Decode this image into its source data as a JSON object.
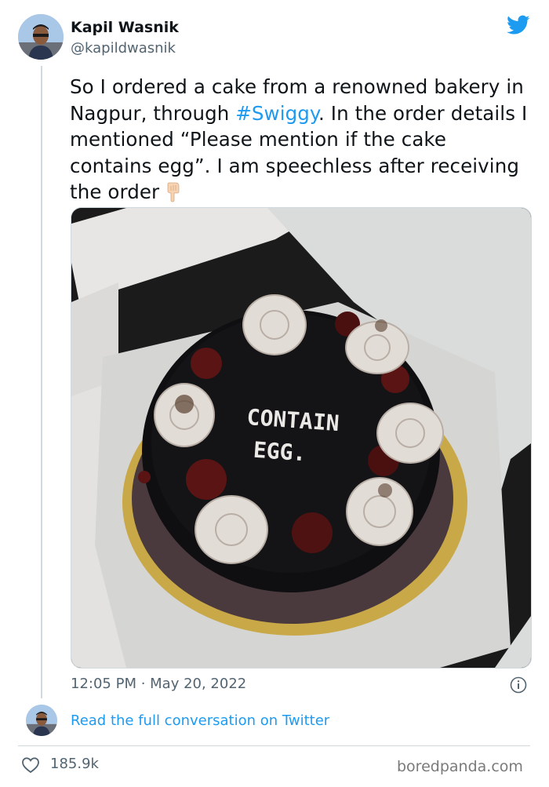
{
  "author": {
    "display_name": "Kapil Wasnik",
    "handle": "@kapildwasnik"
  },
  "tweet": {
    "text_before": "So I ordered a cake from a renowned bakery in Nagpur, through ",
    "hashtag": "#Swiggy",
    "text_after": ". In the order details I mentioned “Please mention if the cake contains egg”. I am speechless after receiving the order",
    "emoji": "pointing-down-hand-emoji",
    "photo_icing_text_line1": "CONTAIN",
    "photo_icing_text_line2": "EGG.",
    "timestamp": "12:05 PM · May 20, 2022"
  },
  "conversation_link": "Read the full conversation on Twitter",
  "likes": "185.9k",
  "watermark": "boredpanda.com",
  "colors": {
    "link_blue": "#1d9bf0",
    "text_primary": "#0f1419",
    "text_secondary": "#536471"
  }
}
